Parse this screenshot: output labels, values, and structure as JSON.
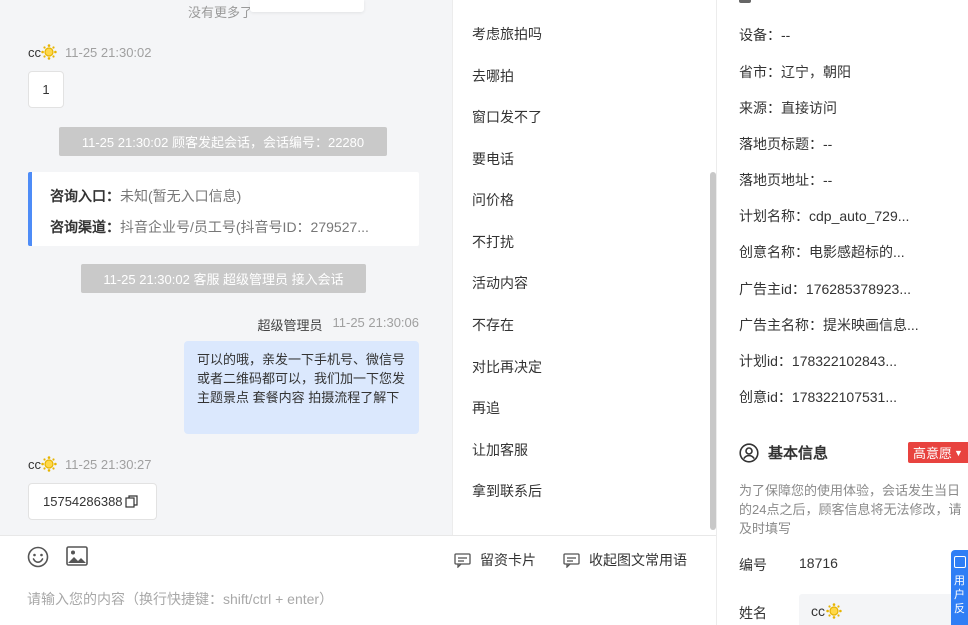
{
  "chat": {
    "no_more": "没有更多了",
    "messages": [
      {
        "name": "cc",
        "time": "11-25 21:30:02",
        "text": "1"
      },
      {
        "name": "cc",
        "time": "11-25 21:30:27",
        "text": "15754286388"
      }
    ],
    "system_events": [
      "11-25 21:30:02 顾客发起会话，会话编号：22280",
      "11-25 21:30:02 客服 超级管理员 接入会话"
    ],
    "entry_card": {
      "entry_label": "咨询入口：",
      "entry_value": "未知(暂无入口信息)",
      "channel_label": "咨询渠道：",
      "channel_value": "抖音企业号/员工号(抖音号ID：279527..."
    },
    "agent_message": {
      "name": "超级管理员",
      "time": "11-25 21:30:06",
      "text": "可以的哦，亲发一下手机号、微信号或者二维码都可以，我们加一下您发主题景点 套餐内容 拍摄流程了解下"
    }
  },
  "quick_replies": [
    "考虑旅拍吗",
    "去哪拍",
    "窗口发不了",
    "要电话",
    "问价格",
    "不打扰",
    "活动内容",
    "不存在",
    "对比再决定",
    "再追",
    "让加客服",
    "拿到联系后"
  ],
  "input_bar": {
    "leave_card": "留资卡片",
    "collapse_phrases": "收起图文常用语",
    "placeholder": "请输入您的内容（换行快捷键：shift/ctrl + enter）"
  },
  "info_panel": {
    "rows": [
      {
        "label": "设备：",
        "value": "--"
      },
      {
        "label": "省市：",
        "value": "辽宁，朝阳"
      },
      {
        "label": "来源：",
        "value": "直接访问"
      },
      {
        "label": "落地页标题：",
        "value": "--"
      },
      {
        "label": "落地页地址：",
        "value": "--"
      },
      {
        "label": "计划名称：",
        "value": "cdp_auto_729..."
      },
      {
        "label": "创意名称：",
        "value": "电影感超标的..."
      },
      {
        "label": "广告主id：",
        "value": "176285378923..."
      },
      {
        "label": "广告主名称：",
        "value": "提米映画信息..."
      },
      {
        "label": "计划id：",
        "value": "178322102843..."
      },
      {
        "label": "创意id：",
        "value": "178322107531..."
      }
    ],
    "basic_info_title": "基本信息",
    "intent_tag": "高意愿",
    "privacy_note": "为了保障您的使用体验，会话发生当日的24点之后，顾客信息将无法修改，请及时填写",
    "id_label": "编号",
    "id_value": "18716",
    "name_label": "姓名",
    "name_value": "cc"
  },
  "float_button": {
    "text": "用户反"
  },
  "colors": {
    "accent_blue": "#4e8cf7",
    "agent_bubble": "#dbe8fd",
    "system_pill": "#c9c9c9",
    "intent_red": "#e8433f"
  },
  "icons": {
    "avatar": "sun-emoji-icon",
    "emoji": "smiley-icon",
    "image": "image-icon",
    "card": "message-card-icon",
    "copy": "copy-icon",
    "basic_info": "user-circle-icon"
  }
}
